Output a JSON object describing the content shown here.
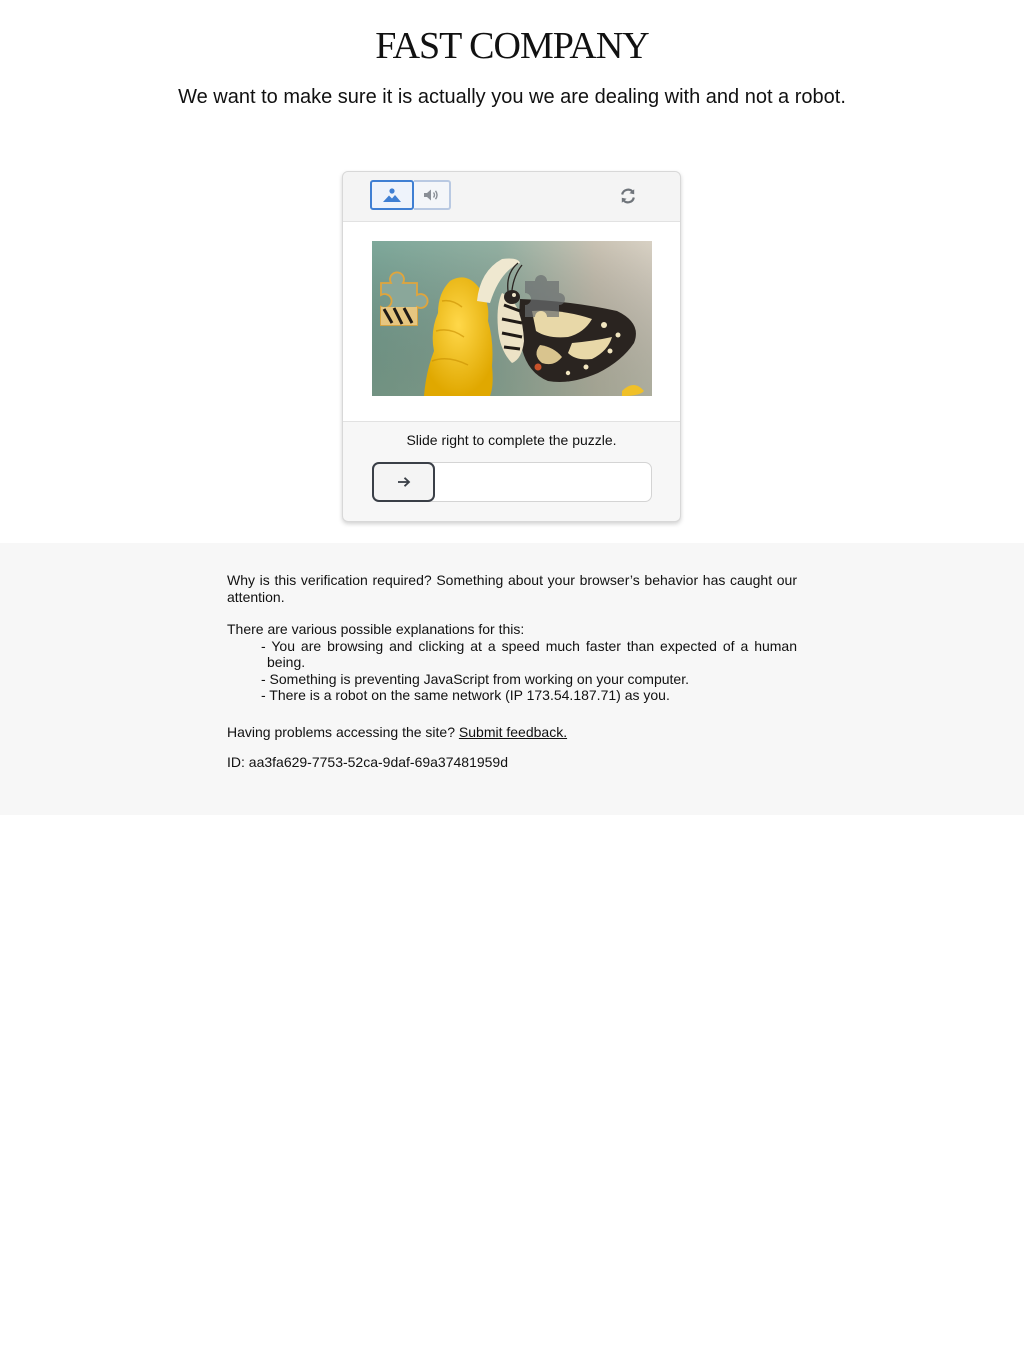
{
  "header": {
    "logo_text": "FAST COMPANY",
    "headline": "We want to make sure it is actually you we are dealing with and not a robot."
  },
  "captcha": {
    "modes": [
      {
        "icon": "image-icon",
        "selected": true
      },
      {
        "icon": "audio-icon",
        "selected": false
      }
    ],
    "refresh_icon": "refresh-icon",
    "instruction": "Slide right to complete the puzzle.",
    "slider_icon": "arrow-right-icon",
    "slider_progress": 0,
    "accent_color": "#3f7fd3"
  },
  "info": {
    "why": "Why is this verification required? Something about your browser’s behavior has caught our attention.",
    "explanations_intro": "There are various possible explanations for this:",
    "reasons": [
      "- You are browsing and clicking at a speed much faster than expected of a human being.",
      "- Something is preventing JavaScript from working on your computer.",
      "- There is a robot on the same network (IP 173.54.187.71) as you."
    ],
    "problems_text": "Having problems accessing the site?",
    "feedback_link": "Submit feedback.",
    "id_line": "ID: aa3fa629-7753-52ca-9daf-69a37481959d"
  }
}
